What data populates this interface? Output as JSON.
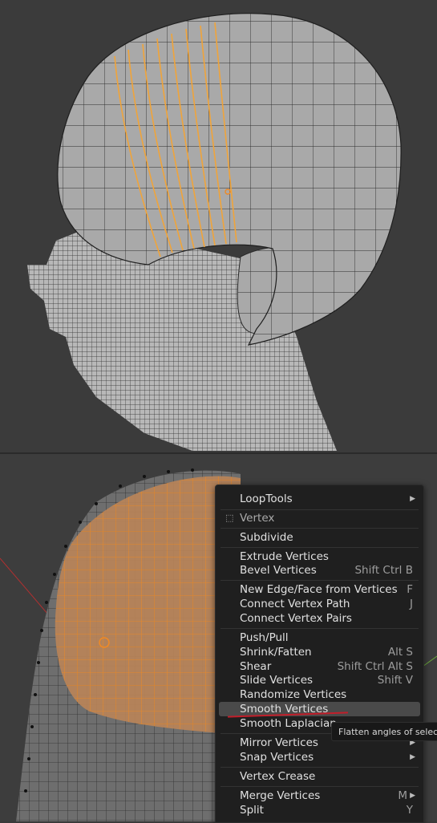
{
  "menu": {
    "loop_tools": "LoopTools",
    "header": "Vertex",
    "items": [
      {
        "label": "Subdivide",
        "shortcut": ""
      },
      {
        "label": "Extrude Vertices",
        "shortcut": ""
      },
      {
        "label": "Bevel Vertices",
        "shortcut": "Shift Ctrl B"
      },
      {
        "label": "New Edge/Face from Vertices",
        "shortcut": "F"
      },
      {
        "label": "Connect Vertex Path",
        "shortcut": "J"
      },
      {
        "label": "Connect Vertex Pairs",
        "shortcut": ""
      },
      {
        "label": "Push/Pull",
        "shortcut": ""
      },
      {
        "label": "Shrink/Fatten",
        "shortcut": "Alt S"
      },
      {
        "label": "Shear",
        "shortcut": "Shift Ctrl Alt S"
      },
      {
        "label": "Slide Vertices",
        "shortcut": "Shift V"
      },
      {
        "label": "Randomize Vertices",
        "shortcut": ""
      },
      {
        "label": "Smooth Vertices",
        "shortcut": ""
      },
      {
        "label": "Smooth Laplacian",
        "shortcut": ""
      },
      {
        "label": "Mirror Vertices",
        "shortcut": ""
      },
      {
        "label": "Snap Vertices",
        "shortcut": ""
      },
      {
        "label": "Vertex Crease",
        "shortcut": ""
      },
      {
        "label": "Merge Vertices",
        "shortcut": "M"
      },
      {
        "label": "Split",
        "shortcut": "Y"
      }
    ]
  },
  "tooltip": "Flatten angles of selected",
  "colors": {
    "accent": "#f08a24",
    "highlight": "#4a4a4a",
    "menu_bg": "#1f1f1f",
    "annotation": "#c21e2a"
  }
}
